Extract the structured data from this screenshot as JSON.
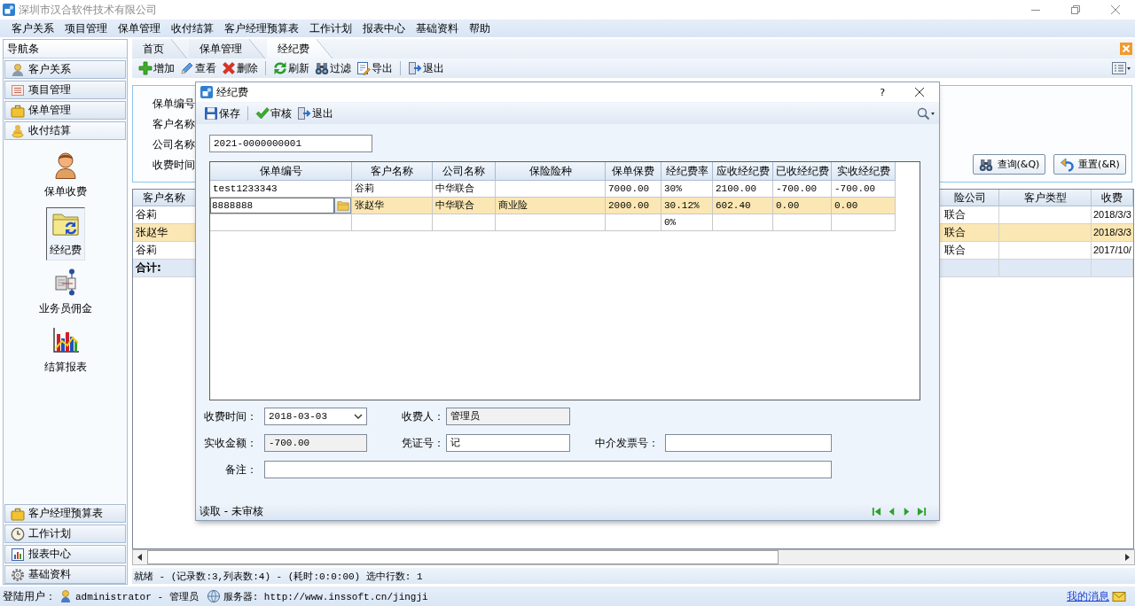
{
  "window": {
    "title": "深圳市汉合软件技术有限公司"
  },
  "menu": [
    "客户关系",
    "项目管理",
    "保单管理",
    "收付结算",
    "客户经理预算表",
    "工作计划",
    "报表中心",
    "基础资料",
    "帮助"
  ],
  "nav": {
    "title": "导航条",
    "sections": [
      {
        "label": "客户关系",
        "expanded": false
      },
      {
        "label": "项目管理",
        "expanded": false
      },
      {
        "label": "保单管理",
        "expanded": false
      },
      {
        "label": "收付结算",
        "expanded": true,
        "items": [
          {
            "label": "保单收费",
            "selected": false
          },
          {
            "label": "经纪费",
            "selected": true
          },
          {
            "label": "业务员佣金",
            "selected": false
          },
          {
            "label": "结算报表",
            "selected": false
          }
        ]
      },
      {
        "label": "客户经理预算表",
        "expanded": false
      },
      {
        "label": "工作计划",
        "expanded": false
      },
      {
        "label": "报表中心",
        "expanded": false
      },
      {
        "label": "基础资料",
        "expanded": false
      }
    ]
  },
  "tabs": [
    {
      "label": "首页",
      "selected": false
    },
    {
      "label": "保单管理",
      "selected": false
    },
    {
      "label": "经纪费",
      "selected": true
    }
  ],
  "toolbar": [
    [
      "增加",
      "查看",
      "删除"
    ],
    [
      "刷新",
      "过滤",
      "导出"
    ],
    [
      "退出"
    ]
  ],
  "search": {
    "labels": [
      "保单编号",
      "客户名称",
      "公司名称",
      "收费时间"
    ],
    "buttons": [
      "查询(&Q)",
      "重置(&R)"
    ]
  },
  "list": {
    "columns": [
      "客户名称",
      "险公司",
      "客户类型",
      "收费"
    ],
    "rows": [
      {
        "customer": "谷莉",
        "insurer": "联合",
        "date": "2018/3/3",
        "selected": false
      },
      {
        "customer": "张赵华",
        "insurer": "联合",
        "date": "2018/3/3",
        "selected": true
      },
      {
        "customer": "谷莉",
        "insurer": "联合",
        "date": "2017/10/",
        "selected": false
      }
    ],
    "total_label": "合计:"
  },
  "status": "就绪 - (记录数:3,列表数:4) - (耗时:0:0:00) 选中行数: 1",
  "dialog": {
    "title": "经纪费",
    "help": "?",
    "toolbar": [
      [
        "保存"
      ],
      [
        "审核",
        "退出"
      ]
    ],
    "policy_no": "2021-0000000001",
    "grid": {
      "columns": [
        "保单编号",
        "客户名称",
        "公司名称",
        "保险险种",
        "保单保费",
        "经纪费率",
        "应收经纪费",
        "已收经纪费",
        "实收经纪费"
      ],
      "rows": [
        {
          "selected": false,
          "editing": false,
          "cells": {
            "policy_no": "test1233343",
            "customer": "谷莉",
            "company": "中华联合",
            "premium": "7000.00",
            "rate": "30%",
            "receivable": "2100.00",
            "received": "-700.00",
            "actual": "-700.00"
          }
        },
        {
          "selected": true,
          "editing": true,
          "cells": {
            "policy_no": "8888888",
            "customer": "张赵华",
            "company": "中华联合",
            "type": "商业险",
            "premium": "2000.00",
            "rate": "30.12%",
            "receivable": "602.40",
            "received": "0.00",
            "actual": "0.00"
          }
        },
        {
          "selected": false,
          "editing": false,
          "cells": {
            "rate": "0%"
          }
        }
      ]
    },
    "form": [
      [
        {
          "kind": "dropdown",
          "label": "收费时间：",
          "value": "2018-03-03"
        },
        {
          "kind": "readonly",
          "label": "收费人：",
          "value": "管理员"
        }
      ],
      [
        {
          "kind": "readonly",
          "label": "实收金额：",
          "value": "-700.00"
        },
        {
          "kind": "text",
          "label": "凭证号：",
          "value": "记"
        },
        {
          "kind": "text",
          "label": "中介发票号："
        }
      ],
      [
        {
          "kind": "text",
          "label": "备注："
        }
      ]
    ],
    "status": "读取 - 未审核"
  },
  "footer": {
    "user_label": "登陆用户：",
    "user": "administrator - 管理员",
    "server": "服务器: http://www.inssoft.cn/jingji",
    "messages_link": "我的消息"
  }
}
